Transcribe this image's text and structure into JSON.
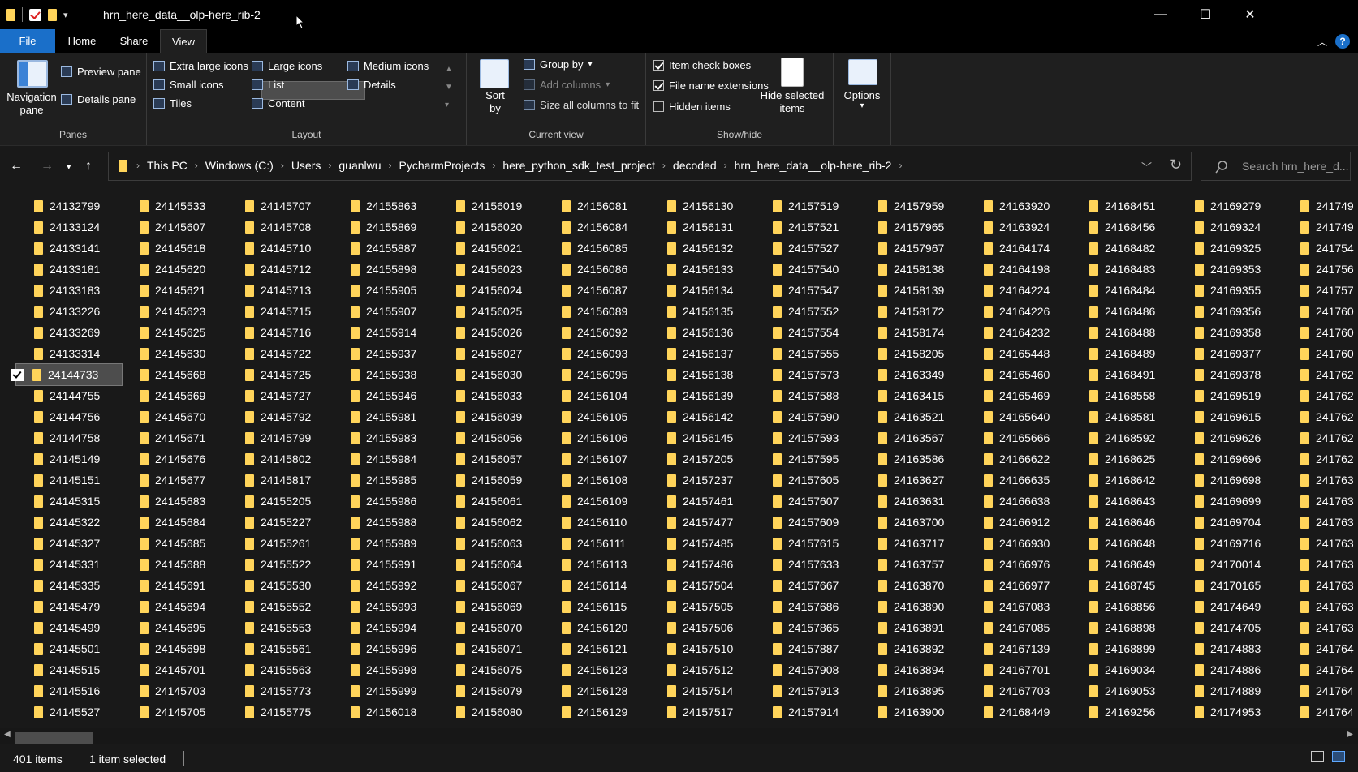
{
  "window": {
    "title": "hrn_here_data__olp-here_rib-2",
    "minimize_glyph": "—",
    "maximize_glyph": "☐",
    "close_glyph": "✕"
  },
  "ribbon_tabs": [
    {
      "label": "File"
    },
    {
      "label": "Home"
    },
    {
      "label": "Share"
    },
    {
      "label": "View"
    }
  ],
  "panes": {
    "navigation_pane": "Navigation pane",
    "preview_pane": "Preview pane",
    "details_pane": "Details pane",
    "group_label": "Panes"
  },
  "layout": {
    "extra_large_icons": "Extra large icons",
    "large_icons": "Large icons",
    "medium_icons": "Medium icons",
    "small_icons": "Small icons",
    "list": "List",
    "details": "Details",
    "tiles": "Tiles",
    "content": "Content",
    "group_label": "Layout",
    "selected": "List"
  },
  "current_view": {
    "sort_by": "Sort by",
    "group_by": "Group by",
    "add_columns": "Add columns",
    "size_all_columns": "Size all columns to fit",
    "group_label": "Current view"
  },
  "show_hide": {
    "item_check_boxes": {
      "label": "Item check boxes",
      "checked": true
    },
    "file_name_extensions": {
      "label": "File name extensions",
      "checked": true
    },
    "hidden_items": {
      "label": "Hidden items",
      "checked": false
    },
    "hide_selected_items": "Hide selected items",
    "group_label": "Show/hide"
  },
  "options": {
    "label": "Options"
  },
  "address": {
    "breadcrumbs": [
      "This PC",
      "Windows (C:)",
      "Users",
      "guanlwu",
      "PycharmProjects",
      "here_python_sdk_test_project",
      "decoded",
      "hrn_here_data__olp-here_rib-2"
    ],
    "search_placeholder": "Search hrn_here_d..."
  },
  "folders": [
    [
      "24132799",
      "24133124",
      "24133141",
      "24133181",
      "24133183",
      "24133226",
      "24133269",
      "24133314",
      "24144733",
      "24144755",
      "24144756",
      "24144758",
      "24145149",
      "24145151",
      "24145315",
      "24145322",
      "24145327",
      "24145331",
      "24145335",
      "24145479",
      "24145499",
      "24145501",
      "24145515",
      "24145516",
      "24145527"
    ],
    [
      "24145533",
      "24145607",
      "24145618",
      "24145620",
      "24145621",
      "24145623",
      "24145625",
      "24145630",
      "24145668",
      "24145669",
      "24145670",
      "24145671",
      "24145676",
      "24145677",
      "24145683",
      "24145684",
      "24145685",
      "24145688",
      "24145691",
      "24145694",
      "24145695",
      "24145698",
      "24145701",
      "24145703",
      "24145705"
    ],
    [
      "24145707",
      "24145708",
      "24145710",
      "24145712",
      "24145713",
      "24145715",
      "24145716",
      "24145722",
      "24145725",
      "24145727",
      "24145792",
      "24145799",
      "24145802",
      "24145817",
      "24155205",
      "24155227",
      "24155261",
      "24155522",
      "24155530",
      "24155552",
      "24155553",
      "24155561",
      "24155563",
      "24155773",
      "24155775"
    ],
    [
      "24155863",
      "24155869",
      "24155887",
      "24155898",
      "24155905",
      "24155907",
      "24155914",
      "24155937",
      "24155938",
      "24155946",
      "24155981",
      "24155983",
      "24155984",
      "24155985",
      "24155986",
      "24155988",
      "24155989",
      "24155991",
      "24155992",
      "24155993",
      "24155994",
      "24155996",
      "24155998",
      "24155999",
      "24156018"
    ],
    [
      "24156019",
      "24156020",
      "24156021",
      "24156023",
      "24156024",
      "24156025",
      "24156026",
      "24156027",
      "24156030",
      "24156033",
      "24156039",
      "24156056",
      "24156057",
      "24156059",
      "24156061",
      "24156062",
      "24156063",
      "24156064",
      "24156067",
      "24156069",
      "24156070",
      "24156071",
      "24156075",
      "24156079",
      "24156080"
    ],
    [
      "24156081",
      "24156084",
      "24156085",
      "24156086",
      "24156087",
      "24156089",
      "24156092",
      "24156093",
      "24156095",
      "24156104",
      "24156105",
      "24156106",
      "24156107",
      "24156108",
      "24156109",
      "24156110",
      "24156111",
      "24156113",
      "24156114",
      "24156115",
      "24156120",
      "24156121",
      "24156123",
      "24156128",
      "24156129"
    ],
    [
      "24156130",
      "24156131",
      "24156132",
      "24156133",
      "24156134",
      "24156135",
      "24156136",
      "24156137",
      "24156138",
      "24156139",
      "24156142",
      "24156145",
      "24157205",
      "24157237",
      "24157461",
      "24157477",
      "24157485",
      "24157486",
      "24157504",
      "24157505",
      "24157506",
      "24157510",
      "24157512",
      "24157514",
      "24157517"
    ],
    [
      "24157519",
      "24157521",
      "24157527",
      "24157540",
      "24157547",
      "24157552",
      "24157554",
      "24157555",
      "24157573",
      "24157588",
      "24157590",
      "24157593",
      "24157595",
      "24157605",
      "24157607",
      "24157609",
      "24157615",
      "24157633",
      "24157667",
      "24157686",
      "24157865",
      "24157887",
      "24157908",
      "24157913",
      "24157914"
    ],
    [
      "24157959",
      "24157965",
      "24157967",
      "24158138",
      "24158139",
      "24158172",
      "24158174",
      "24158205",
      "24163349",
      "24163415",
      "24163521",
      "24163567",
      "24163586",
      "24163627",
      "24163631",
      "24163700",
      "24163717",
      "24163757",
      "24163870",
      "24163890",
      "24163891",
      "24163892",
      "24163894",
      "24163895",
      "24163900"
    ],
    [
      "24163920",
      "24163924",
      "24164174",
      "24164198",
      "24164224",
      "24164226",
      "24164232",
      "24165448",
      "24165460",
      "24165469",
      "24165640",
      "24165666",
      "24166622",
      "24166635",
      "24166638",
      "24166912",
      "24166930",
      "24166976",
      "24166977",
      "24167083",
      "24167085",
      "24167139",
      "24167701",
      "24167703",
      "24168449"
    ],
    [
      "24168451",
      "24168456",
      "24168482",
      "24168483",
      "24168484",
      "24168486",
      "24168488",
      "24168489",
      "24168491",
      "24168558",
      "24168581",
      "24168592",
      "24168625",
      "24168642",
      "24168643",
      "24168646",
      "24168648",
      "24168649",
      "24168745",
      "24168856",
      "24168898",
      "24168899",
      "24169034",
      "24169053",
      "24169256"
    ],
    [
      "24169279",
      "24169324",
      "24169325",
      "24169353",
      "24169355",
      "24169356",
      "24169358",
      "24169377",
      "24169378",
      "24169519",
      "24169615",
      "24169626",
      "24169696",
      "24169698",
      "24169699",
      "24169704",
      "24169716",
      "24170014",
      "24170165",
      "24174649",
      "24174705",
      "24174883",
      "24174886",
      "24174889",
      "24174953"
    ],
    [
      "241749",
      "241749",
      "241754",
      "241756",
      "241757",
      "241760",
      "241760",
      "241760",
      "241762",
      "241762",
      "241762",
      "241762",
      "241762",
      "241763",
      "241763",
      "241763",
      "241763",
      "241763",
      "241763",
      "241763",
      "241763",
      "241764",
      "241764",
      "241764",
      "241764"
    ]
  ],
  "selected_folder": "24144733",
  "status": {
    "item_count": "401 items",
    "selection": "1 item selected"
  },
  "colors": {
    "accent": "#1a6fc9",
    "folder": "#ffd45a",
    "background": "#191919"
  }
}
